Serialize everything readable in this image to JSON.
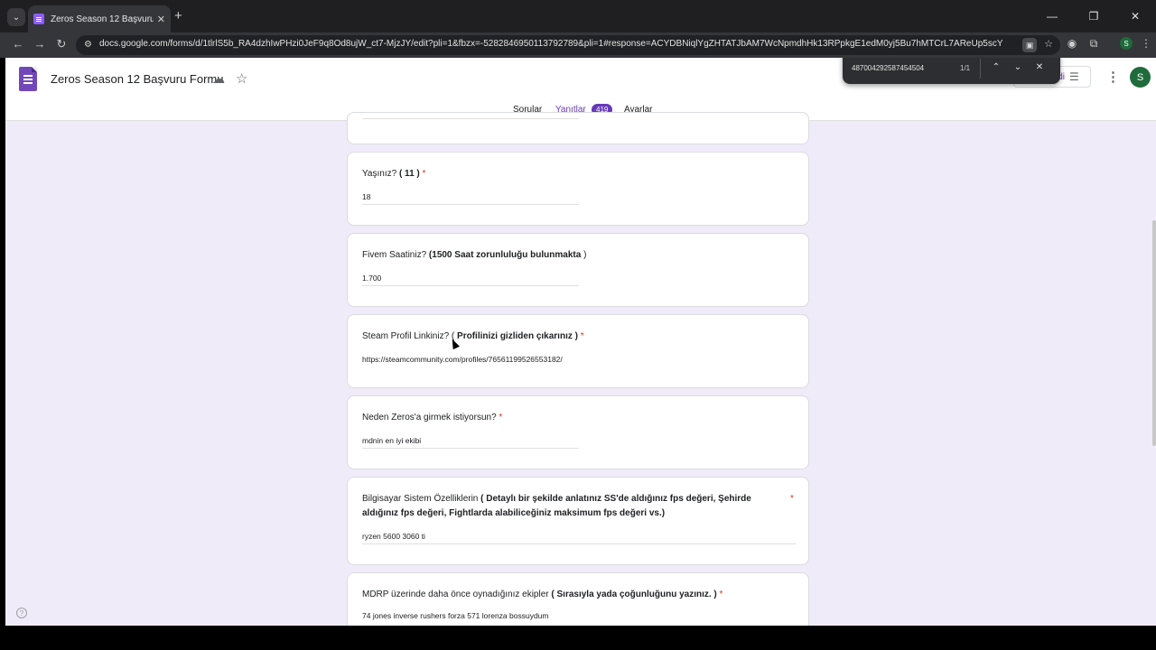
{
  "browser": {
    "tab_title": "Zeros Season 12 Başvuru Formu",
    "tab_close": "✕",
    "new_tab": "+",
    "url": "docs.google.com/forms/d/1tlrlS5b_RA4dzhIwPHzi0JeF9q8Od8ujW_ct7-MjzJY/edit?pli=1&fbzx=-5282846950113792789&pli=1#response=ACYDBNiqlYgZHTATJbAM7WcNpmdhHk13RPpkgE1edM0yj5Bu7hMTCrL7AReUp5scYg",
    "profile_initial": "S"
  },
  "find_bar": {
    "query": "487004292587454504",
    "count": "1/1"
  },
  "form": {
    "title": "Zeros Season 12 Başvuru Formu",
    "publish_label": "di",
    "avatar_initial": "S",
    "tabs": {
      "questions": "Sorular",
      "responses": "Yanıtlar",
      "responses_count": "419",
      "settings": "Ayarlar"
    }
  },
  "questions": [
    {
      "plain": "Yaşınız?",
      "bold": "( 11 )",
      "required": "*",
      "answer": "18"
    },
    {
      "plain": "Fivem Saatiniz?",
      "bold": "(1500 Saat zorunluluğu bulunmakta",
      "tail": ")",
      "required": "",
      "answer": "1.700"
    },
    {
      "plain": "Steam Profil Linkiniz? (",
      "bold": "Profilinizi gizliden çıkarınız )",
      "required": "*",
      "answer": "https://steamcommunity.com/profiles/76561199526553182/"
    },
    {
      "plain": "Neden Zeros'a girmek istiyorsun?",
      "bold": "",
      "required": "*",
      "answer": "mdnin en iyi ekibi"
    },
    {
      "plain": "Bilgisayar Sistem Özelliklerin",
      "bold": "( Detaylı bir şekilde anlatınız SS'de aldığınız fps değeri, Şehirde",
      "bold2": "aldığınız fps değeri, Fightlarda alabiliceğiniz maksimum fps değeri vs.)",
      "required": "*",
      "answer": "ryzen 5600 3060 ti"
    },
    {
      "plain": "MDRP üzerinde daha önce oynadığınız ekipler",
      "bold": "( Sırasıyla yada çoğunluğunu yazınız. )",
      "required": "*",
      "answer": "74 jones inverse rushers forza 571 lorenza bossuydum"
    }
  ]
}
